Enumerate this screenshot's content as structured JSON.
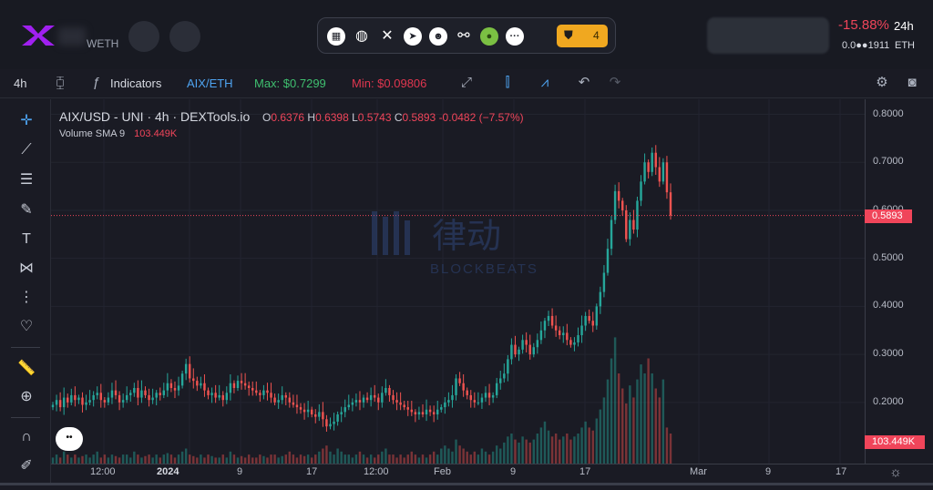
{
  "header": {
    "pair_quote": "WETH",
    "change_pct": "-15.88%",
    "change_period": "24h",
    "price_eth": "0.0●●1911",
    "price_eth_unit": "ETH",
    "audit_count": "4",
    "colors": {
      "negative": "#f0455a",
      "badge": "#f0a820"
    }
  },
  "socials": [
    "chart-icon",
    "globe-icon",
    "x-icon",
    "telegram-icon",
    "reddit-icon",
    "link-icon",
    "coingecko-icon",
    "more-icon"
  ],
  "toolbar": {
    "interval": "4h",
    "indicators_label": "Indicators",
    "pair_toggle": "AIX/ETH",
    "max_label": "Max: $0.7299",
    "min_label": "Min: $0.09806"
  },
  "legend": {
    "title": "AIX/USD - UNI · 4h · DEXTools.io",
    "o_key": "O",
    "o_val": "0.6376",
    "h_key": "H",
    "h_val": "0.6398",
    "l_key": "L",
    "l_val": "0.5743",
    "c_key": "C",
    "c_val": "0.5893",
    "change": "-0.0482 (−7.57%)",
    "volume_label": "Volume SMA 9",
    "volume_val": "103.449K"
  },
  "price_tag": "0.5893",
  "volume_tag": "103.449K",
  "mini_button": "••",
  "watermark": {
    "cn": "律动",
    "en": "BLOCKBEATS"
  },
  "chart_data": {
    "type": "candlestick",
    "title": "AIX/USD - UNI · 4h · DEXTools.io",
    "y_ticks": [
      "0.8000",
      "0.7000",
      "0.6000",
      "0.5000",
      "0.4000",
      "0.3000",
      "0.2000"
    ],
    "ylim": [
      0.12,
      0.82
    ],
    "x_ticks": [
      "12:00",
      "2024",
      "9",
      "17",
      "12:00",
      "Feb",
      "9",
      "17",
      "Mar",
      "9",
      "17"
    ],
    "last_close": 0.5893,
    "max": 0.7299,
    "min": 0.09806,
    "colors": {
      "up": "#26a69a",
      "down": "#ef5350",
      "last_line": "#f0455a"
    },
    "closes": [
      0.195,
      0.205,
      0.19,
      0.21,
      0.2,
      0.215,
      0.205,
      0.21,
      0.195,
      0.2,
      0.205,
      0.215,
      0.22,
      0.205,
      0.2,
      0.21,
      0.225,
      0.215,
      0.2,
      0.205,
      0.215,
      0.22,
      0.23,
      0.21,
      0.225,
      0.215,
      0.205,
      0.21,
      0.22,
      0.215,
      0.225,
      0.24,
      0.23,
      0.225,
      0.235,
      0.26,
      0.28,
      0.25,
      0.245,
      0.235,
      0.24,
      0.225,
      0.215,
      0.22,
      0.21,
      0.215,
      0.205,
      0.22,
      0.24,
      0.23,
      0.245,
      0.24,
      0.235,
      0.23,
      0.225,
      0.22,
      0.215,
      0.225,
      0.22,
      0.21,
      0.2,
      0.205,
      0.215,
      0.21,
      0.2,
      0.195,
      0.19,
      0.185,
      0.18,
      0.185,
      0.175,
      0.17,
      0.18,
      0.165,
      0.15,
      0.155,
      0.16,
      0.175,
      0.18,
      0.19,
      0.195,
      0.2,
      0.205,
      0.2,
      0.21,
      0.205,
      0.215,
      0.21,
      0.2,
      0.22,
      0.23,
      0.215,
      0.205,
      0.2,
      0.195,
      0.19,
      0.185,
      0.18,
      0.175,
      0.18,
      0.175,
      0.185,
      0.18,
      0.175,
      0.185,
      0.19,
      0.2,
      0.205,
      0.215,
      0.25,
      0.24,
      0.225,
      0.215,
      0.205,
      0.2,
      0.2,
      0.21,
      0.22,
      0.21,
      0.215,
      0.24,
      0.25,
      0.26,
      0.29,
      0.32,
      0.3,
      0.31,
      0.33,
      0.32,
      0.3,
      0.315,
      0.33,
      0.35,
      0.37,
      0.38,
      0.36,
      0.35,
      0.34,
      0.345,
      0.33,
      0.32,
      0.325,
      0.34,
      0.36,
      0.38,
      0.37,
      0.36,
      0.4,
      0.43,
      0.47,
      0.52,
      0.58,
      0.64,
      0.62,
      0.6,
      0.54,
      0.58,
      0.56,
      0.62,
      0.66,
      0.7,
      0.68,
      0.72,
      0.69,
      0.66,
      0.7,
      0.6376,
      0.5893
    ],
    "volumes": [
      0.02,
      0.03,
      0.02,
      0.04,
      0.03,
      0.02,
      0.03,
      0.02,
      0.025,
      0.03,
      0.02,
      0.03,
      0.04,
      0.02,
      0.03,
      0.02,
      0.03,
      0.025,
      0.02,
      0.03,
      0.03,
      0.02,
      0.04,
      0.03,
      0.02,
      0.025,
      0.03,
      0.02,
      0.03,
      0.02,
      0.03,
      0.035,
      0.03,
      0.02,
      0.03,
      0.04,
      0.05,
      0.03,
      0.025,
      0.02,
      0.03,
      0.02,
      0.03,
      0.025,
      0.02,
      0.02,
      0.03,
      0.02,
      0.04,
      0.03,
      0.02,
      0.025,
      0.02,
      0.03,
      0.02,
      0.02,
      0.03,
      0.025,
      0.02,
      0.03,
      0.03,
      0.02,
      0.025,
      0.03,
      0.04,
      0.03,
      0.02,
      0.03,
      0.025,
      0.03,
      0.02,
      0.03,
      0.04,
      0.05,
      0.06,
      0.04,
      0.03,
      0.05,
      0.04,
      0.03,
      0.03,
      0.02,
      0.03,
      0.04,
      0.03,
      0.02,
      0.03,
      0.02,
      0.03,
      0.04,
      0.05,
      0.03,
      0.03,
      0.02,
      0.03,
      0.02,
      0.03,
      0.04,
      0.03,
      0.02,
      0.03,
      0.02,
      0.03,
      0.04,
      0.03,
      0.05,
      0.06,
      0.05,
      0.04,
      0.08,
      0.06,
      0.05,
      0.04,
      0.03,
      0.04,
      0.03,
      0.05,
      0.04,
      0.03,
      0.04,
      0.06,
      0.05,
      0.07,
      0.09,
      0.1,
      0.08,
      0.07,
      0.09,
      0.08,
      0.07,
      0.08,
      0.1,
      0.12,
      0.14,
      0.11,
      0.09,
      0.1,
      0.08,
      0.09,
      0.1,
      0.08,
      0.09,
      0.1,
      0.12,
      0.14,
      0.12,
      0.11,
      0.15,
      0.18,
      0.22,
      0.28,
      0.35,
      0.42,
      0.3,
      0.25,
      0.2,
      0.26,
      0.22,
      0.28,
      0.33,
      0.3,
      0.35,
      0.3,
      0.25,
      0.22,
      0.28,
      0.12,
      0.1
    ]
  }
}
